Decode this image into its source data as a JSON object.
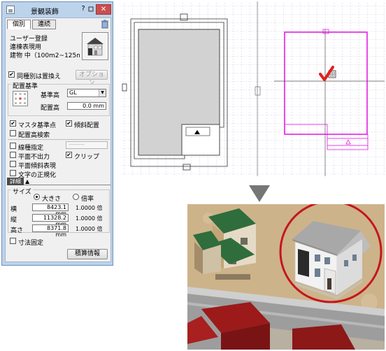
{
  "dialog": {
    "title": "景観装飾",
    "help_label": "?",
    "minimize_label": "▭",
    "close_label": "✕",
    "tabs": [
      {
        "label": "個別"
      },
      {
        "label": "連続"
      }
    ],
    "info": {
      "line1": "ユーザー登録",
      "line2": "連棟表現用",
      "line3": "建物 中（100m2~125m"
    },
    "replace_checkbox": {
      "label": "同種別は置換え",
      "checked": true
    },
    "options_button": "オプション",
    "placement": {
      "group_label": "配置基準",
      "base_height_label": "基準高",
      "base_height_value": "GL",
      "placement_height_label": "配置高",
      "placement_height_value": "0.0 mm"
    },
    "checks": {
      "master_point": {
        "label": "マスタ基準点",
        "checked": true
      },
      "slope_placement": {
        "label": "傾斜配置",
        "checked": true
      },
      "placement_height_search": {
        "label": "配置高検索",
        "checked": false
      },
      "line_type": {
        "label": "線種指定",
        "checked": false
      },
      "line_type_value": "---------",
      "no_plan_output": {
        "label": "平面不出力",
        "checked": false
      },
      "clip": {
        "label": "クリップ",
        "checked": true
      },
      "plan_slope": {
        "label": "平面傾斜表現",
        "checked": false
      },
      "text_normalize": {
        "label": "文字の正規化",
        "checked": false
      }
    },
    "detail_tab": "詳細",
    "detail_arrow": "▲",
    "size": {
      "group_label": "サイズ",
      "size_radio": {
        "label": "大きさ",
        "selected": true
      },
      "scale_radio": {
        "label": "倍率",
        "selected": false
      },
      "rows": [
        {
          "label": "横",
          "value": "8423.1 mm",
          "ratio": "1.0000 倍"
        },
        {
          "label": "縦",
          "value": "11328.2 mm",
          "ratio": "1.0000 倍"
        },
        {
          "label": "高さ",
          "value": "8371.8 mm",
          "ratio": "1.0000 倍"
        }
      ]
    },
    "fixed_size": {
      "label": "寸法固定",
      "checked": false
    },
    "estimate_button": "積算情報"
  },
  "icons": {
    "trash": "trash-icon",
    "building": "building-icon",
    "placement_grid": "placement-grid-icon",
    "checkmark": "checkmark-icon"
  },
  "colors": {
    "selected_outline": "#e000e0",
    "check_mark": "#e0201c",
    "render_circle": "#c4161c",
    "roof_green": "#2f6d3c",
    "roof_red": "#9c1a1a"
  }
}
